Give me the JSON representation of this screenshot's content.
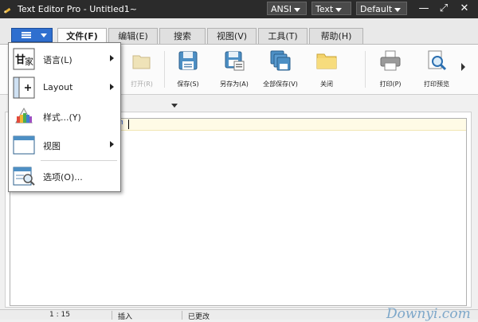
{
  "titlebar": {
    "title": "Text Editor Pro  -  Untitled1~",
    "encoding": "ANSI",
    "syntax": "Text",
    "theme": "Default",
    "minimize": "—",
    "restore": "⤢",
    "close": "✕"
  },
  "tabs": [
    "文件(F)",
    "编辑(E)",
    "搜索",
    "视图(V)",
    "工具(T)",
    "帮助(H)"
  ],
  "ribbon": {
    "items": [
      {
        "label": "打开(R)",
        "icon": "open-folder-icon"
      },
      {
        "label": "保存(S)",
        "icon": "save-icon"
      },
      {
        "label": "另存为(A)",
        "icon": "save-as-icon"
      },
      {
        "label": "全部保存(V)",
        "icon": "save-all-icon"
      },
      {
        "label": "关闭",
        "icon": "close-folder-icon"
      },
      {
        "label": "打印(P)",
        "icon": "printer-icon"
      },
      {
        "label": "打印预览",
        "icon": "print-preview-icon"
      }
    ]
  },
  "editor": {
    "fragment": "m"
  },
  "dropdown": {
    "items": [
      {
        "label": "语言(L)",
        "icon": "language-icon",
        "submenu": true
      },
      {
        "label": "Layout",
        "icon": "layout-icon",
        "submenu": true
      },
      {
        "label": "样式...(Y)",
        "icon": "palette-icon",
        "submenu": false
      },
      {
        "label": "视图",
        "icon": "view-window-icon",
        "submenu": true
      },
      {
        "label": "选项(O)...",
        "icon": "options-icon",
        "submenu": false
      }
    ]
  },
  "statusbar": {
    "position": "1 : 15",
    "mode": "插入",
    "status": "已更改"
  },
  "watermark": "Downyi.com",
  "colors": {
    "accent": "#2f6fcf",
    "titlebar": "#2b2b2b",
    "current_line": "#fffbe6"
  }
}
